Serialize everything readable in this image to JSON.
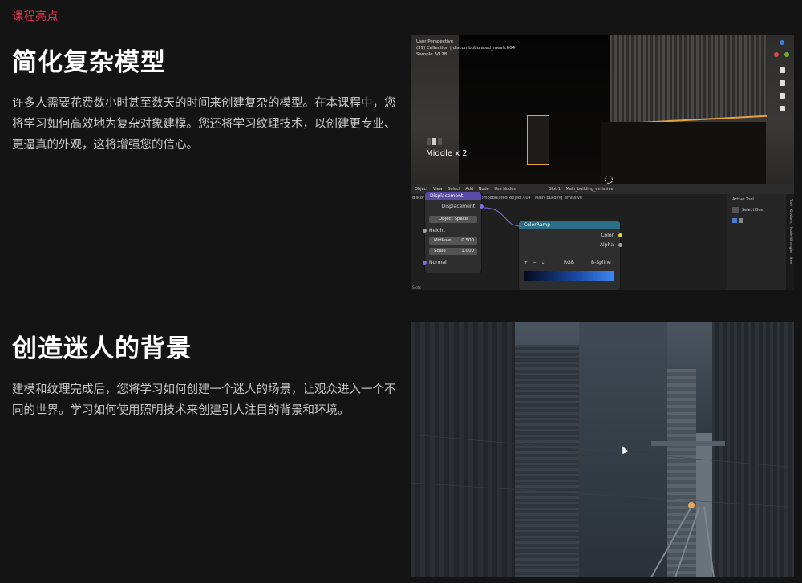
{
  "section_tag": "课程亮点",
  "features": [
    {
      "title": "简化复杂模型",
      "description": "许多人需要花费数小时甚至数天的时间来创建复杂的模型。在本课程中，您将学习如何高效地为复杂对象建模。您还将学习纹理技术，以创建更专业、更逼真的外观，这将增强您的信心。"
    },
    {
      "title": "创造迷人的背景",
      "description": "建模和纹理完成后，您将学习如何创建一个迷人的场景，让观众进入一个不同的世界。学习如何使用照明技术来创建引人注目的背景和环境。"
    }
  ],
  "editor": {
    "viewport_info": [
      "User Perspective",
      "(39) Collection | discombobulated_mesh.004",
      "Sample 3/128"
    ],
    "overlay_text": "Middle x 2",
    "header_items": [
      "Object",
      "View",
      "Select",
      "Add",
      "Node",
      "Use Nodes",
      "Slot 1",
      "Main_building_emissive"
    ],
    "breadcrumb": [
      "discombobulated_mesh.004",
      "discombobulated_object.004",
      "Main_building_emissive"
    ],
    "displacement_node": {
      "title": "Displacement",
      "output": "Displacement",
      "space": "Object Space",
      "inputs": [
        "Height",
        "Normal"
      ],
      "fields": [
        {
          "label": "Midlevel",
          "value": "0.500"
        },
        {
          "label": "Scale",
          "value": "1.000"
        }
      ]
    },
    "colorramp_node": {
      "title": "ColorRamp",
      "outputs": [
        "Color",
        "Alpha"
      ],
      "mode": "RGB",
      "interpolation": "B-Spline",
      "controls": [
        "+",
        "−",
        "⌄"
      ]
    },
    "active_tool": {
      "title": "Active Tool",
      "item": "Select Box"
    },
    "side_tabs": [
      "Tool",
      "Options",
      "Node Wrangler",
      "Item"
    ],
    "footer": "Slots",
    "colors": {
      "accent_orange": "#e8a042",
      "node_purple": "#5a4aa8",
      "node_teal": "#2b6f86"
    }
  }
}
